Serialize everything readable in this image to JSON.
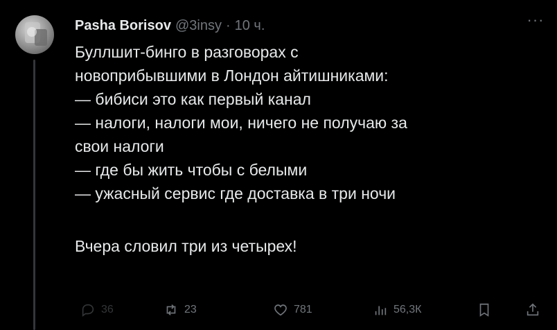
{
  "author": {
    "name": "Pasha Borisov",
    "handle": "@3insy",
    "separator": "·",
    "time": "10 ч."
  },
  "more_label": "···",
  "tweet": {
    "lines": [
      "Буллшит-бинго в разговорах с",
      "новоприбывшими в Лондон айтишниками:",
      "— бибиси это как первый канал",
      "— налоги, налоги мои, ничего не получаю за",
      "свои налоги",
      "— где бы жить чтобы с белыми",
      "— ужасный сервис где доставка в три ночи"
    ],
    "closing": "Вчера словил три из четырех!"
  },
  "actions": {
    "replies": "36",
    "retweets": "23",
    "likes": "781",
    "views": "56,3К"
  },
  "icons": {
    "reply": "reply-icon",
    "retweet": "retweet-icon",
    "like": "heart-icon",
    "views": "views-icon",
    "bookmark": "bookmark-icon",
    "share": "share-icon"
  },
  "colors": {
    "background": "#000000",
    "text": "#e7e9ea",
    "secondary": "#71767b",
    "thread_line": "#333639"
  }
}
